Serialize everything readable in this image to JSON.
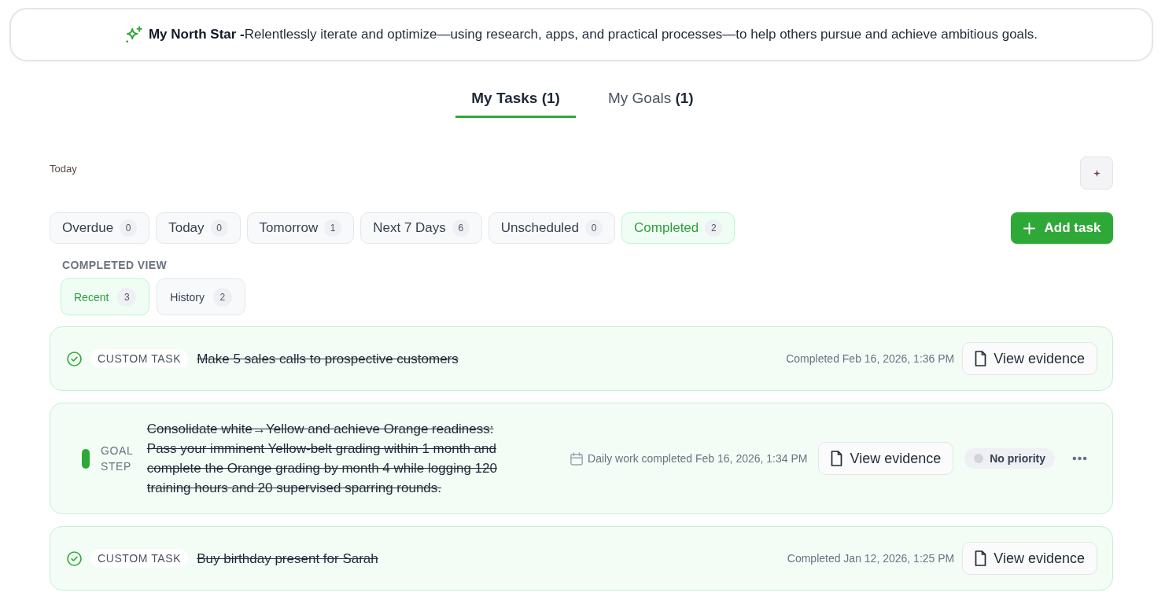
{
  "north_star": "**My North Star -**Relentlessly iterate and optimize—using research, apps, and practical processes—to help others pursue and achieve ambitious goals.",
  "main_tabs": [
    {
      "label": "My Tasks",
      "count": "(1)",
      "selected": true
    },
    {
      "label": "My Goals",
      "count": "(1)",
      "selected": false
    }
  ],
  "section_title": "Today",
  "filters": [
    {
      "label": "Overdue",
      "count": "0",
      "selected": false
    },
    {
      "label": "Today",
      "count": "0",
      "selected": false
    },
    {
      "label": "Tomorrow",
      "count": "1",
      "selected": false
    },
    {
      "label": "Next 7 Days",
      "count": "6",
      "selected": false
    },
    {
      "label": "Unscheduled",
      "count": "0",
      "selected": false
    },
    {
      "label": "Completed",
      "count": "2",
      "selected": true
    }
  ],
  "add_task_button": "Add task",
  "completed_view": {
    "heading": "COMPLETED VIEW",
    "options": [
      {
        "label": "Recent",
        "count": "3",
        "selected": true
      },
      {
        "label": "History",
        "count": "2",
        "selected": false
      }
    ]
  },
  "tasks": [
    {
      "kind": "custom",
      "tag": "CUSTOM TASK",
      "title": "Make 5 sales calls to prospective customers",
      "completed": true,
      "completed_at": "Completed Feb 16, 2026, 1:36 PM",
      "action": "View evidence"
    },
    {
      "kind": "goal_step",
      "tag": "GOAL STEP",
      "title": "Consolidate white→Yellow and achieve Orange readiness: Pass your imminent Yellow-belt grading within 1 month and complete the Orange grading by month 4 while logging 120 training hours and 20 supervised sparring rounds.",
      "completed": true,
      "completed_at": "Daily work completed Feb 16, 2026, 1:34 PM",
      "action": "View evidence",
      "priority": "No priority"
    },
    {
      "kind": "custom",
      "tag": "CUSTOM TASK",
      "title": "Buy birthday present for Sarah",
      "completed": true,
      "completed_at": "Completed Jan 12, 2026, 1:25 PM",
      "action": "View evidence"
    }
  ]
}
